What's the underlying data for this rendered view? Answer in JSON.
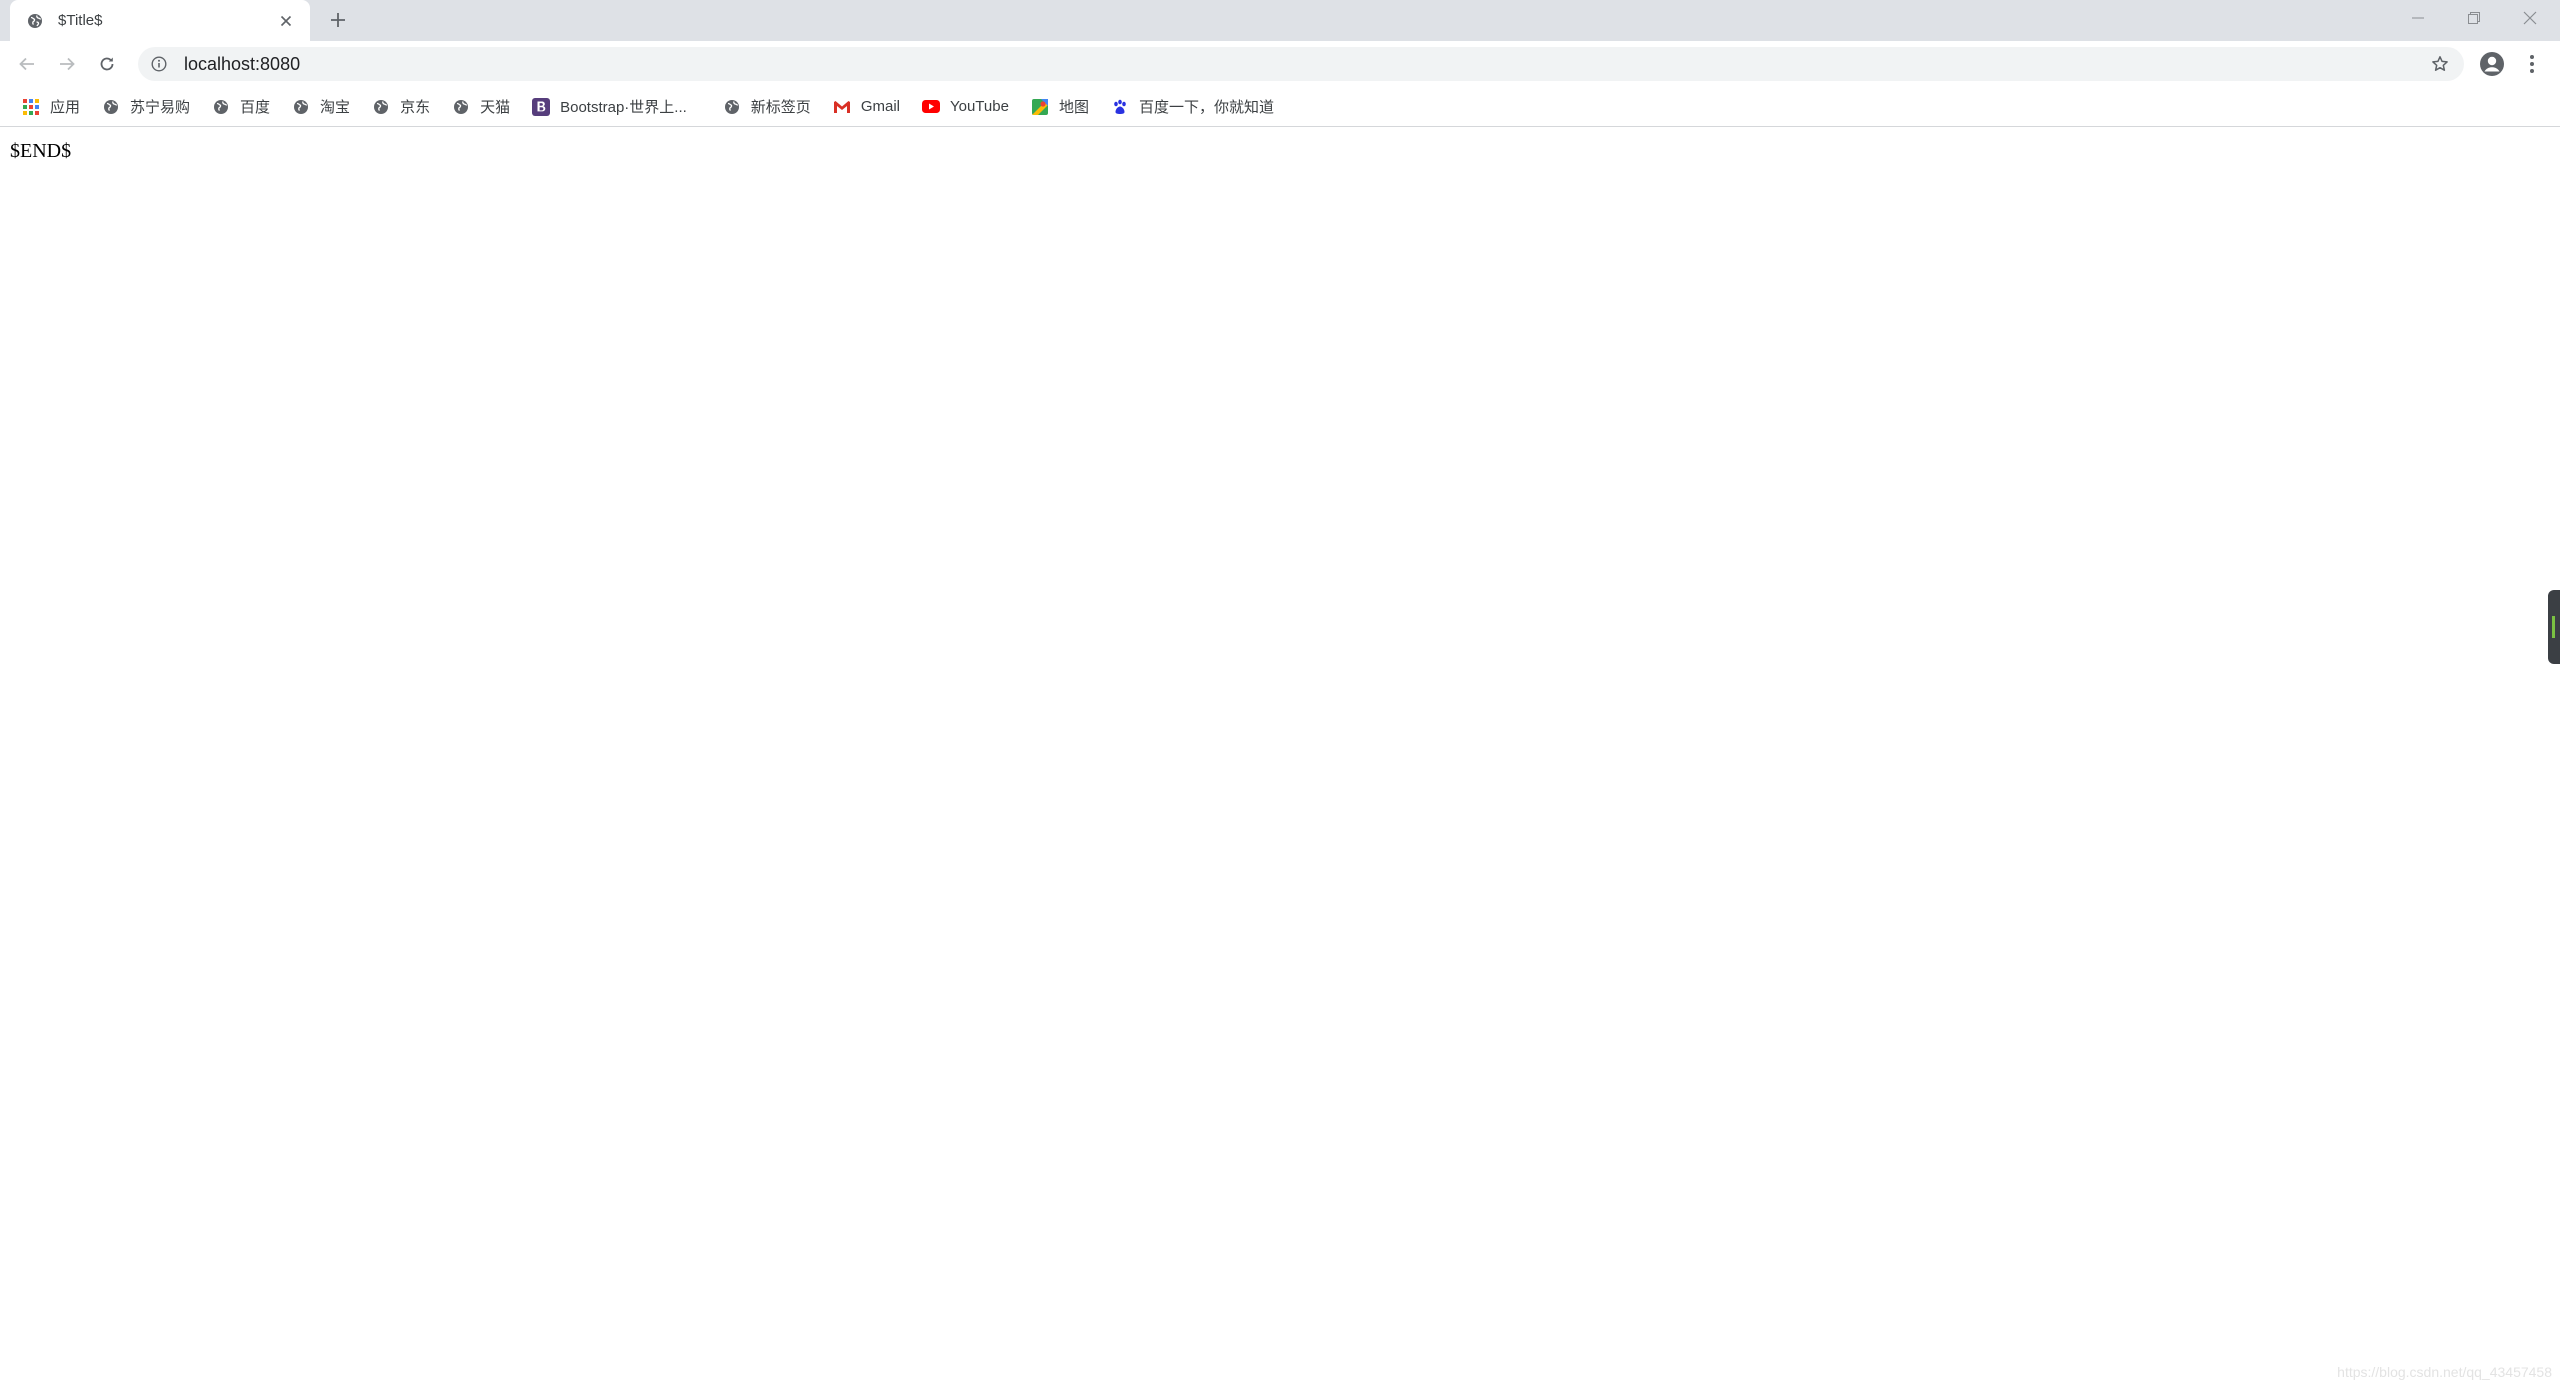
{
  "tab": {
    "title": "$Title$"
  },
  "address_bar": {
    "url": "localhost:8080"
  },
  "bookmarks": [
    {
      "label": "应用",
      "icon": "apps-grid-icon"
    },
    {
      "label": "苏宁易购",
      "icon": "globe-icon"
    },
    {
      "label": "百度",
      "icon": "globe-icon"
    },
    {
      "label": "淘宝",
      "icon": "globe-icon"
    },
    {
      "label": "京东",
      "icon": "globe-icon"
    },
    {
      "label": "天猫",
      "icon": "globe-icon"
    },
    {
      "label": "Bootstrap·世界上...",
      "icon": "bootstrap-icon"
    },
    {
      "label": "新标签页",
      "icon": "globe-icon"
    },
    {
      "label": "Gmail",
      "icon": "gmail-icon"
    },
    {
      "label": "YouTube",
      "icon": "youtube-icon"
    },
    {
      "label": "地图",
      "icon": "maps-icon"
    },
    {
      "label": "百度一下，你就知道",
      "icon": "baidu-paw-icon"
    }
  ],
  "page": {
    "body_text": "$END$",
    "watermark": "https://blog.csdn.net/qq_43457458"
  },
  "colors": {
    "tabstrip": "#dee1e6",
    "omnibox": "#f1f3f4",
    "bootstrap": "#563d7c",
    "youtube": "#ff0000",
    "gmail": "#d93025",
    "baidu": "#2932e1"
  }
}
